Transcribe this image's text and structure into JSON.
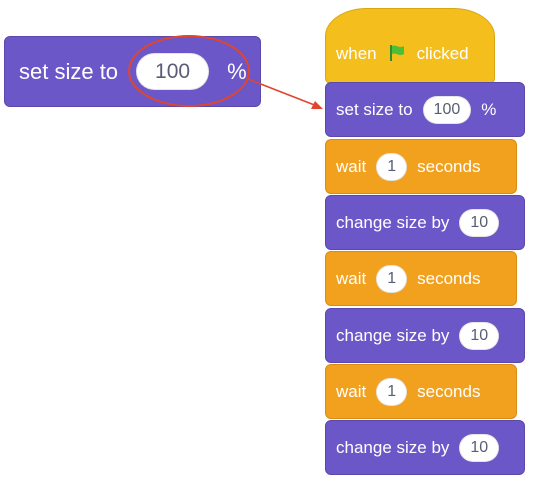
{
  "callout_block": {
    "label": "set size to",
    "value": "100",
    "suffix": "%"
  },
  "hat_block": {
    "prefix": "when",
    "flag_icon": "green-flag-icon",
    "suffix": "clicked"
  },
  "stack": [
    {
      "type": "set_size",
      "label": "set size to",
      "value": "100",
      "suffix": "%"
    },
    {
      "type": "wait",
      "label": "wait",
      "value": "1",
      "suffix": "seconds"
    },
    {
      "type": "change_size",
      "label": "change size by",
      "value": "10"
    },
    {
      "type": "wait",
      "label": "wait",
      "value": "1",
      "suffix": "seconds"
    },
    {
      "type": "change_size",
      "label": "change size by",
      "value": "10"
    },
    {
      "type": "wait",
      "label": "wait",
      "value": "1",
      "suffix": "seconds"
    },
    {
      "type": "change_size",
      "label": "change size by",
      "value": "10"
    }
  ],
  "colors": {
    "looks_block": "#6b57c8",
    "control_block": "#f2a11f",
    "event_block": "#f4be1c",
    "callout_ring": "#e0462d"
  }
}
